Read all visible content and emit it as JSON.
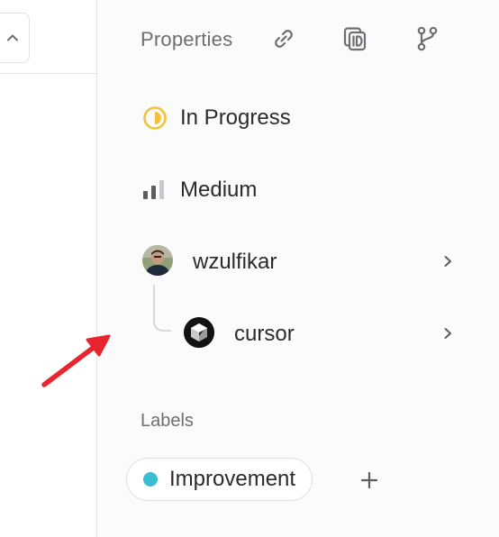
{
  "properties": {
    "title": "Properties"
  },
  "status": {
    "label": "In Progress",
    "color": "#f2c23a"
  },
  "priority": {
    "label": "Medium"
  },
  "assignee": {
    "name": "wzulfikar"
  },
  "delegate": {
    "name": "cursor"
  },
  "labels": {
    "section_title": "Labels",
    "items": [
      {
        "name": "Improvement",
        "color": "#3bbfd0"
      }
    ]
  },
  "colors": {
    "annotation_arrow": "#e8242f",
    "muted_text": "#6e6e73"
  },
  "icons": {
    "header": [
      "link-icon",
      "copy-id-icon",
      "branch-icon"
    ],
    "status": "in-progress-icon",
    "priority": "signal-bars-icon",
    "chevron": "chevron-right-icon",
    "collapse": "chevron-up-icon",
    "add": "plus-icon"
  }
}
